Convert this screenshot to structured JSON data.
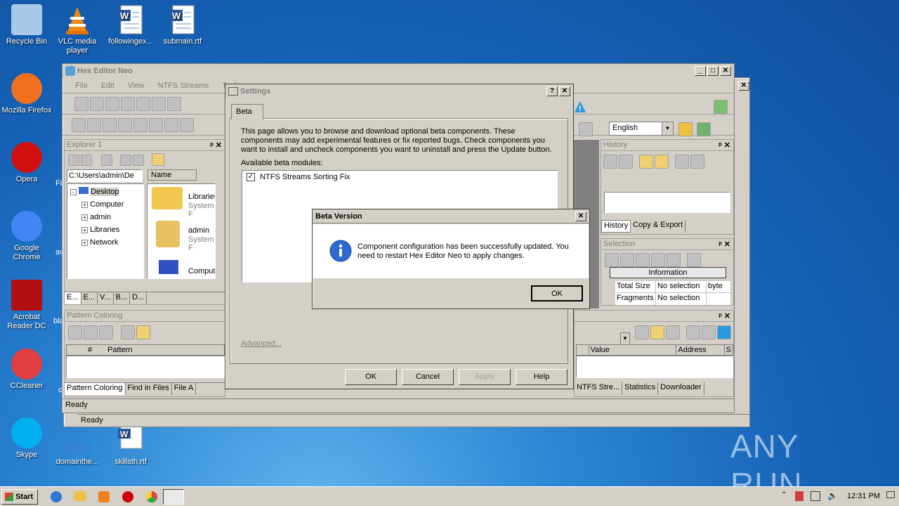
{
  "desktop": {
    "icons_col1": [
      {
        "label": "Recycle Bin",
        "icon": "recycle-bin-icon"
      },
      {
        "label": "Mozilla Firefox",
        "icon": "firefox-icon"
      },
      {
        "label": "Opera",
        "icon": "opera-icon"
      },
      {
        "label": "Google Chrome",
        "icon": "chrome-icon"
      },
      {
        "label": "Acrobat Reader DC",
        "icon": "acrobat-icon"
      },
      {
        "label": "CCleaner",
        "icon": "ccleaner-icon"
      },
      {
        "label": "Skype",
        "icon": "skype-icon"
      }
    ],
    "icons_top": [
      {
        "label": "VLC media player",
        "icon": "vlc-icon"
      },
      {
        "label": "followingex...",
        "icon": "word-doc-icon"
      },
      {
        "label": "submain.rtf",
        "icon": "word-doc-icon"
      }
    ],
    "icons_bottom": [
      {
        "label": "domainthe...",
        "icon": "folder-icon"
      },
      {
        "label": "skillsth.rtf",
        "icon": "word-doc-icon"
      }
    ],
    "partial_labels": [
      "Fi",
      "av",
      "bla",
      "c"
    ],
    "watermark": "ANY RUN"
  },
  "main_window": {
    "title": "Hex Editor Neo",
    "menu": [
      "File",
      "Edit",
      "View",
      "NTFS Streams",
      "Tools"
    ],
    "language": "English",
    "explorer": {
      "title": "Explorer 1",
      "path": "C:\\Users\\admin\\De",
      "tree": [
        "Desktop",
        "Computer",
        "admin",
        "Libraries",
        "Network"
      ],
      "column": "Name",
      "files": [
        {
          "name": "Libraries",
          "type": "System F"
        },
        {
          "name": "admin",
          "type": "System F"
        },
        {
          "name": "Compute",
          "type": ""
        }
      ],
      "tabs": [
        "E...",
        "E...",
        "V...",
        "B...",
        "D..."
      ]
    },
    "pattern": {
      "title": "Pattern Coloring",
      "col_hash": "#",
      "col_pattern": "Pattern",
      "tabs": [
        "Pattern Coloring",
        "Find in Files",
        "File A"
      ]
    },
    "history": {
      "title": "History",
      "tabs": [
        "History",
        "Copy & Export"
      ]
    },
    "selection": {
      "title": "Selection",
      "info_label": "Information",
      "rows": [
        [
          "Total Size",
          "No selection",
          "byte"
        ],
        [
          "Fragments",
          "No selection",
          ""
        ]
      ]
    },
    "bottom_right": {
      "cols": [
        "Value",
        "Address",
        "S"
      ],
      "tabs": [
        "NTFS Stre...",
        "Statistics",
        "Downloader"
      ]
    },
    "status": "Ready",
    "status_outer": "Ready"
  },
  "settings": {
    "title": "Settings",
    "tab": "Beta",
    "description": "This page allows you to browse and download optional beta components. These components may add experimental features or fix reported bugs. Check components you want to install and uncheck components you want to uninstall and press the Update button.",
    "modules_label": "Available beta modules:",
    "modules": [
      {
        "name": "NTFS Streams Sorting Fix",
        "checked": true
      }
    ],
    "advanced": "Advanced...",
    "buttons": {
      "ok": "OK",
      "cancel": "Cancel",
      "apply": "Apply",
      "help": "Help"
    }
  },
  "beta_dialog": {
    "title": "Beta Version",
    "message": "Component configuration has been successfully updated. You need to restart Hex Editor Neo to apply changes.",
    "ok": "OK"
  },
  "taskbar": {
    "start": "Start",
    "time": "12:31 PM"
  }
}
